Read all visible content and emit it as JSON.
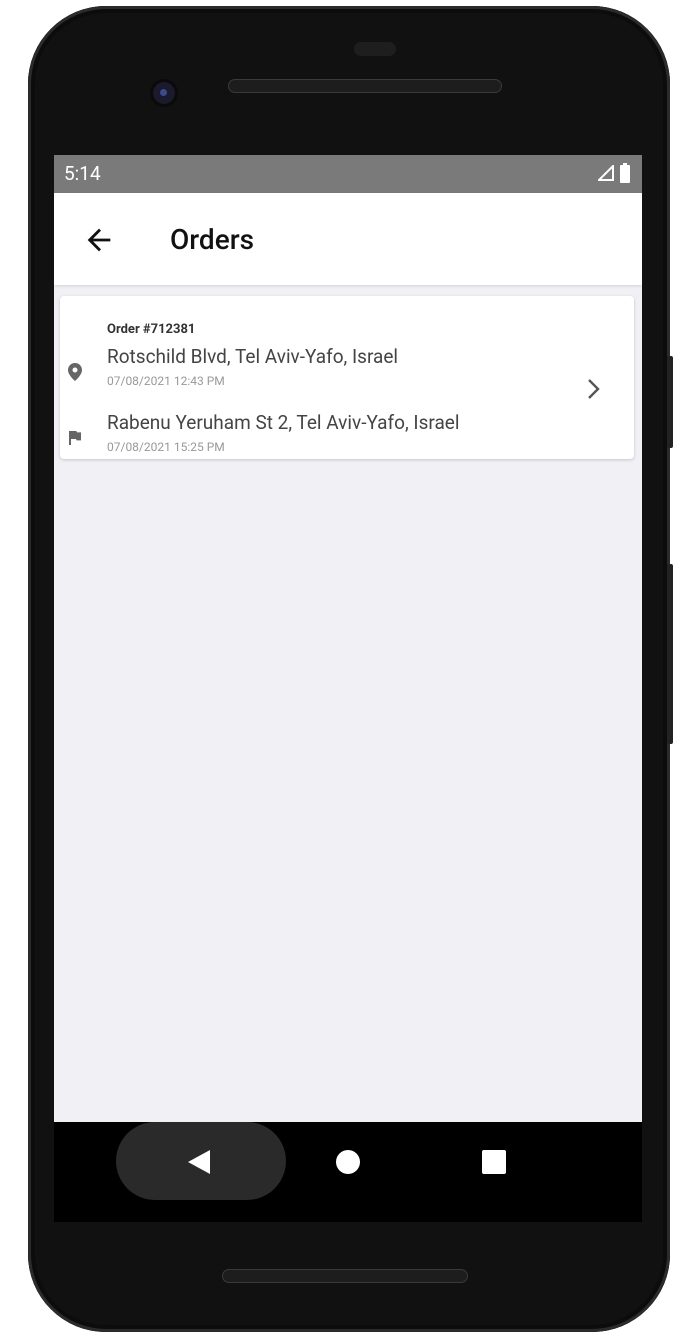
{
  "status_bar": {
    "time": "5:14",
    "icons": [
      "cellular-signal-icon",
      "battery-icon"
    ]
  },
  "app_bar": {
    "back_icon": "arrow-left-icon",
    "title": "Orders"
  },
  "orders": [
    {
      "order_number": "Order #712381",
      "pickup": {
        "icon": "location-pin-icon",
        "address": "Rotschild Blvd, Tel Aviv-Yafo, Israel",
        "timestamp": "07/08/2021 12:43 PM"
      },
      "dropoff": {
        "icon": "flag-icon",
        "address": "Rabenu Yeruham St 2, Tel Aviv-Yafo, Israel",
        "timestamp": "07/08/2021 15:25 PM"
      },
      "action_icon": "chevron-right-icon"
    }
  ],
  "nav_bar": {
    "icons": [
      "back-triangle-icon",
      "home-circle-icon",
      "recents-square-icon"
    ]
  },
  "colors": {
    "background": "#f0f0f5",
    "status_bar": "#7a7a7a",
    "app_bar": "#ffffff",
    "card": "#ffffff",
    "text_primary": "#111111",
    "text_secondary": "#444444",
    "text_muted": "#999999"
  }
}
